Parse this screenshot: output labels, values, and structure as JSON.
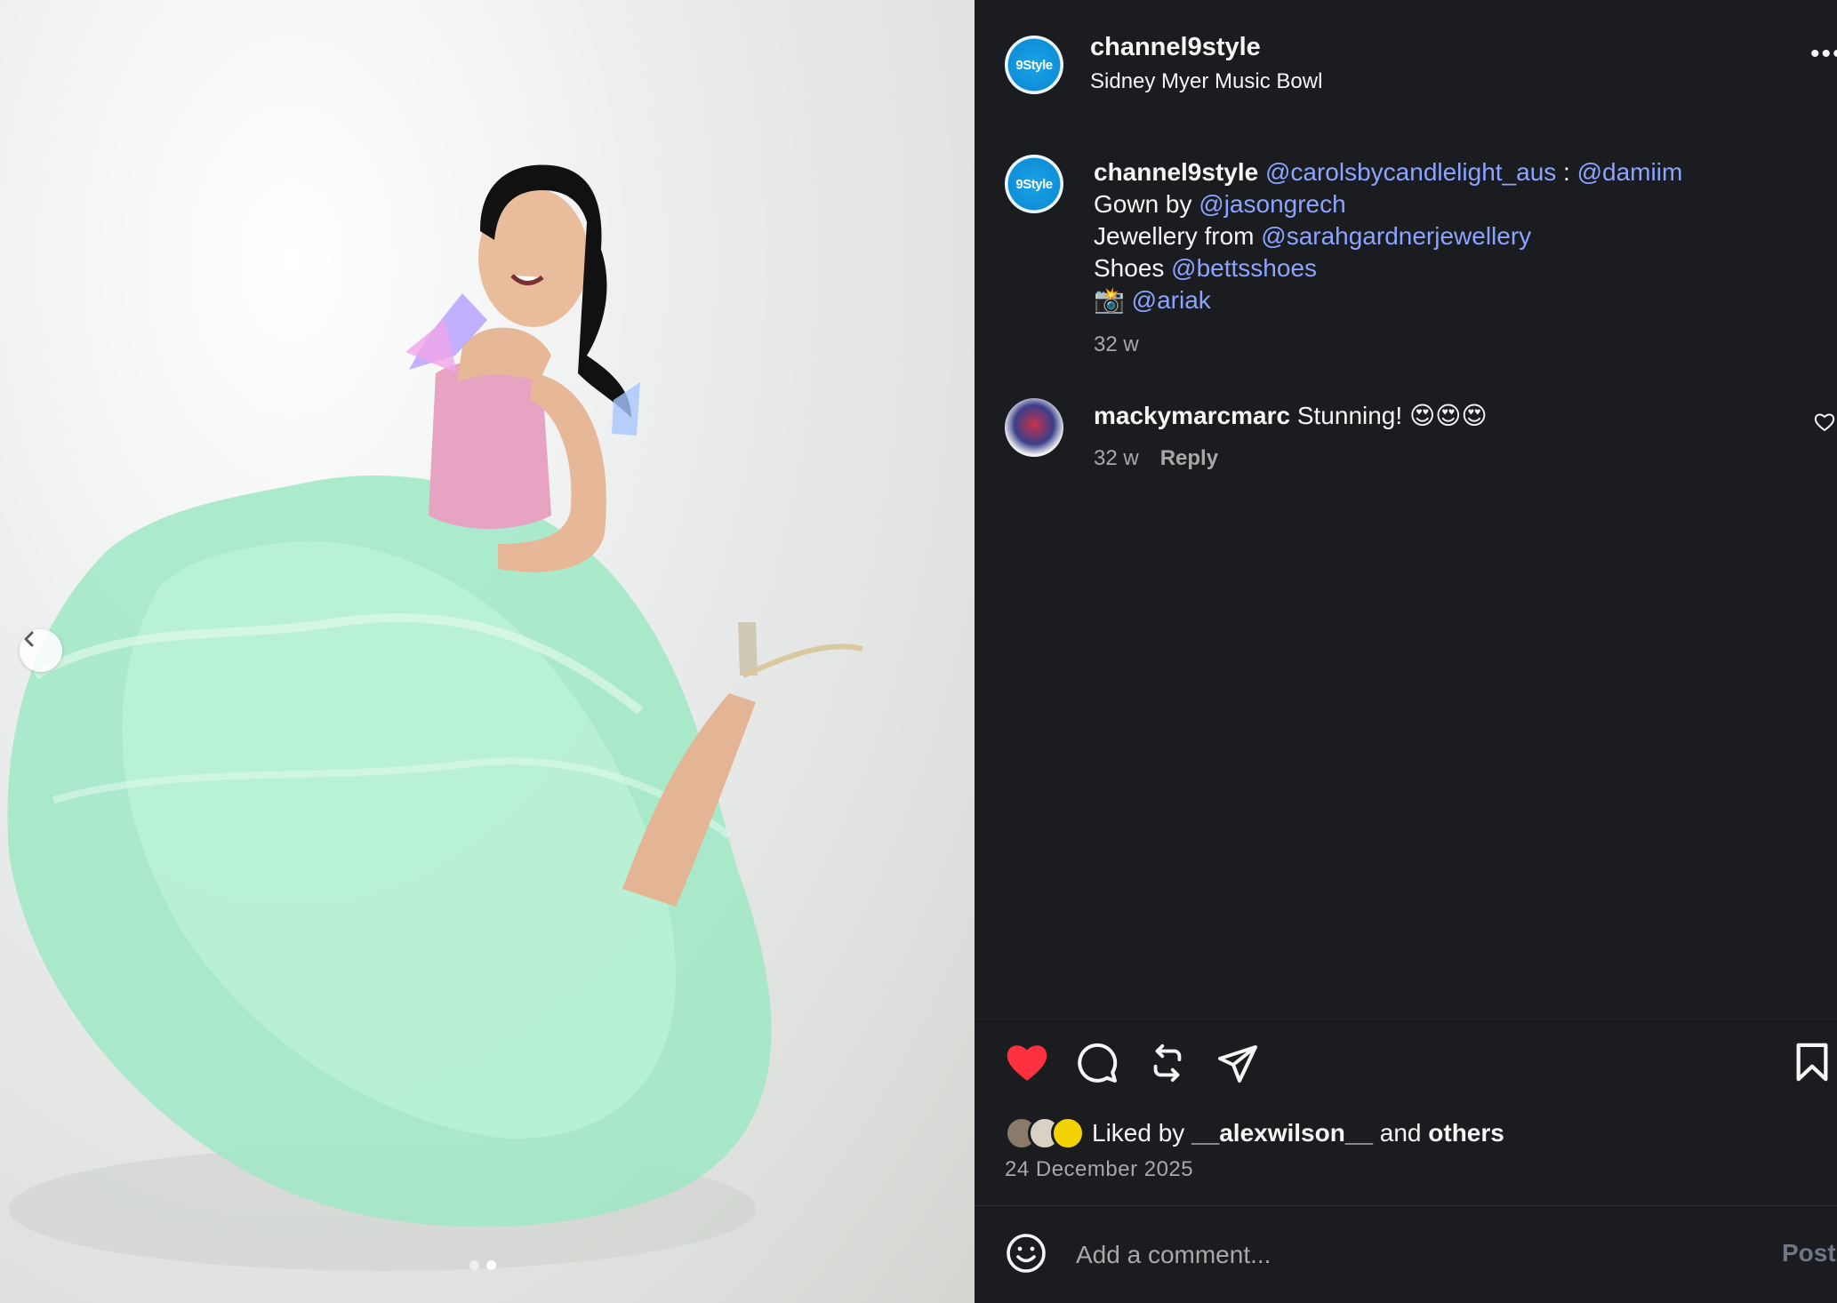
{
  "post": {
    "username": "channel9style",
    "location": "Sidney Myer Music Bowl",
    "avatar_text": "9Style",
    "more_label": "•••"
  },
  "caption": {
    "username": "channel9style",
    "line1_mention1": "@carolsbycandlelight_aus",
    "line1_sep": " : ",
    "line1_mention2": "@damiim",
    "line2_text": "Gown by ",
    "line2_mention": "@jasongrech",
    "line3_text": "Jewellery from ",
    "line3_mention": "@sarahgardnerjewellery",
    "line4_text": "Shoes ",
    "line4_mention": "@bettsshoes",
    "line5_emoji": "📸",
    "line5_mention": "@ariak",
    "time": "32 w"
  },
  "comments": [
    {
      "username": "mackymarcmarc",
      "text": "Stunning! 😍😍😍",
      "time": "32 w",
      "reply_label": "Reply"
    }
  ],
  "actions": {
    "liked_prefix": "Liked by ",
    "liked_user": "__alexwilson__",
    "liked_mid": " and ",
    "liked_others": "others",
    "date": "24 December 2025",
    "like_color": "#ff3040"
  },
  "composer": {
    "placeholder": "Add a comment...",
    "post_label": "Post"
  },
  "carousel": {
    "total": 2,
    "active": 2
  },
  "icons": {
    "prev": "chevron-left-icon",
    "like": "heart-filled-icon",
    "comment": "speech-bubble-icon",
    "repost": "repost-icon",
    "share": "paper-plane-icon",
    "save": "bookmark-icon",
    "emoji": "smiley-icon",
    "more": "more-horizontal-icon"
  }
}
